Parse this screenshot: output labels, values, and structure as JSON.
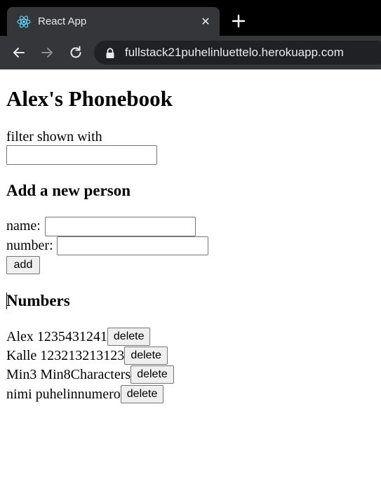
{
  "browser": {
    "tab_title": "React App",
    "tab_close": "✕",
    "url": "fullstack21puhelinluettelo.herokuapp.com"
  },
  "page": {
    "title": "Alex's Phonebook",
    "filter_label": "filter shown with",
    "filter_value": "",
    "add_heading": "Add a new person",
    "name_label": "name:",
    "name_value": "",
    "number_label": "number:",
    "number_value": "",
    "add_button": "add",
    "numbers_heading": "Numbers",
    "persons": [
      {
        "entry": "Alex 1235431241",
        "delete_label": "delete"
      },
      {
        "entry": "Kalle 123213213123",
        "delete_label": "delete"
      },
      {
        "entry": "Min3 Min8Characters",
        "delete_label": "delete"
      },
      {
        "entry": "nimi puhelinnumero",
        "delete_label": "delete"
      }
    ]
  }
}
